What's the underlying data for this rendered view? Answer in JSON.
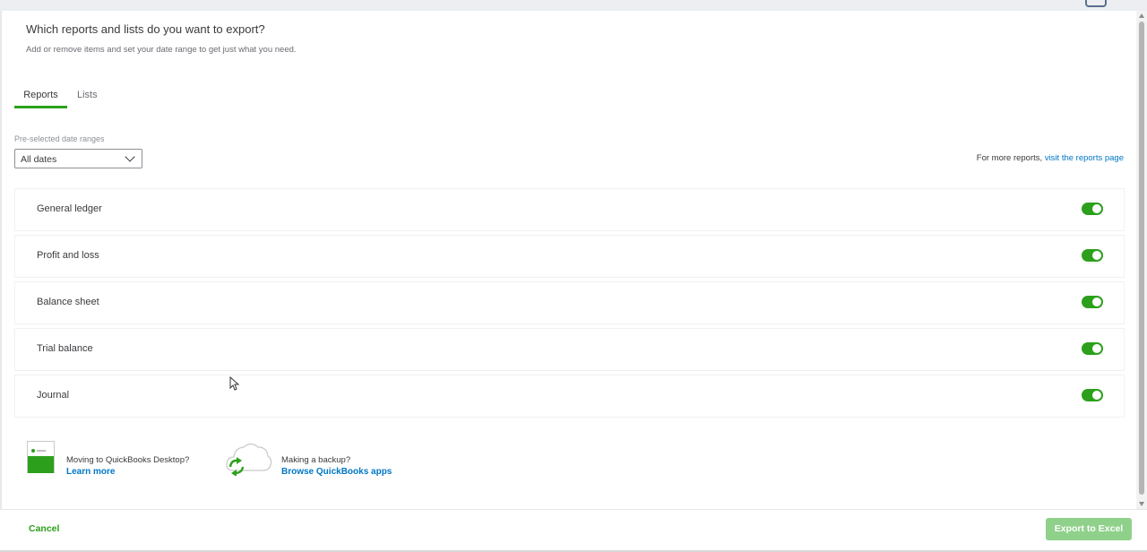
{
  "dialog": {
    "heading": "Which reports and lists do you want to export?",
    "subheading": "Add or remove items and set your date range to get just what you need."
  },
  "tabs": [
    {
      "label": "Reports",
      "active": true
    },
    {
      "label": "Lists",
      "active": false
    }
  ],
  "date_range": {
    "label": "Pre-selected date ranges",
    "selected": "All dates"
  },
  "more_reports": {
    "prefix": "For more reports,",
    "link_text": "visit the reports page"
  },
  "reports": [
    {
      "label": "General ledger",
      "enabled": true
    },
    {
      "label": "Profit and loss",
      "enabled": true
    },
    {
      "label": "Balance sheet",
      "enabled": true
    },
    {
      "label": "Trial balance",
      "enabled": true
    },
    {
      "label": "Journal",
      "enabled": true
    }
  ],
  "promos": {
    "desktop": {
      "title": "Moving to QuickBooks Desktop?",
      "link": "Learn more",
      "icon": "desktop-screen-icon"
    },
    "backup": {
      "title": "Making a backup?",
      "link": "Browse QuickBooks apps",
      "icon": "cloud-sync-icon"
    }
  },
  "footer": {
    "cancel_label": "Cancel",
    "export_label": "Export to Excel"
  },
  "colors": {
    "accent_green": "#2ca01c",
    "link_blue": "#0077c5",
    "export_disabled": "#8fd18a"
  }
}
